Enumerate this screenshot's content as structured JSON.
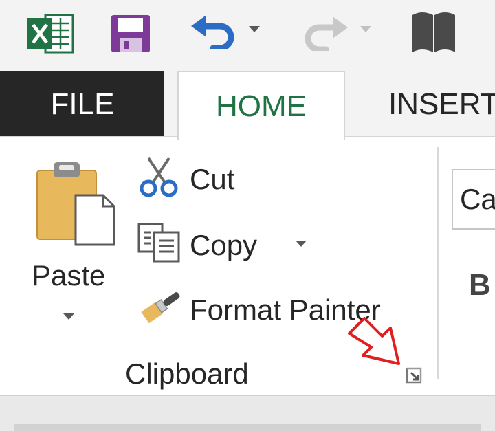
{
  "quick_access": {
    "app_icon": "excel-logo-icon",
    "save_icon": "save-icon",
    "undo_icon": "undo-icon",
    "redo_icon": "redo-icon",
    "touch_mode_icon": "touch-mode-icon"
  },
  "tabs": {
    "file": "FILE",
    "home": "HOME",
    "insert": "INSERT"
  },
  "clipboard": {
    "paste_label": "Paste",
    "cut_label": "Cut",
    "copy_label": "Copy",
    "format_painter_label": "Format Painter",
    "group_label": "Clipboard"
  },
  "font_group": {
    "font_name_value": "Ca",
    "bold_label": "B"
  },
  "colors": {
    "excel_green": "#217346",
    "file_tab_bg": "#262626",
    "annotation_arrow": "#e02020",
    "undo_blue": "#2b6cc4",
    "save_purple": "#7e3a98"
  }
}
